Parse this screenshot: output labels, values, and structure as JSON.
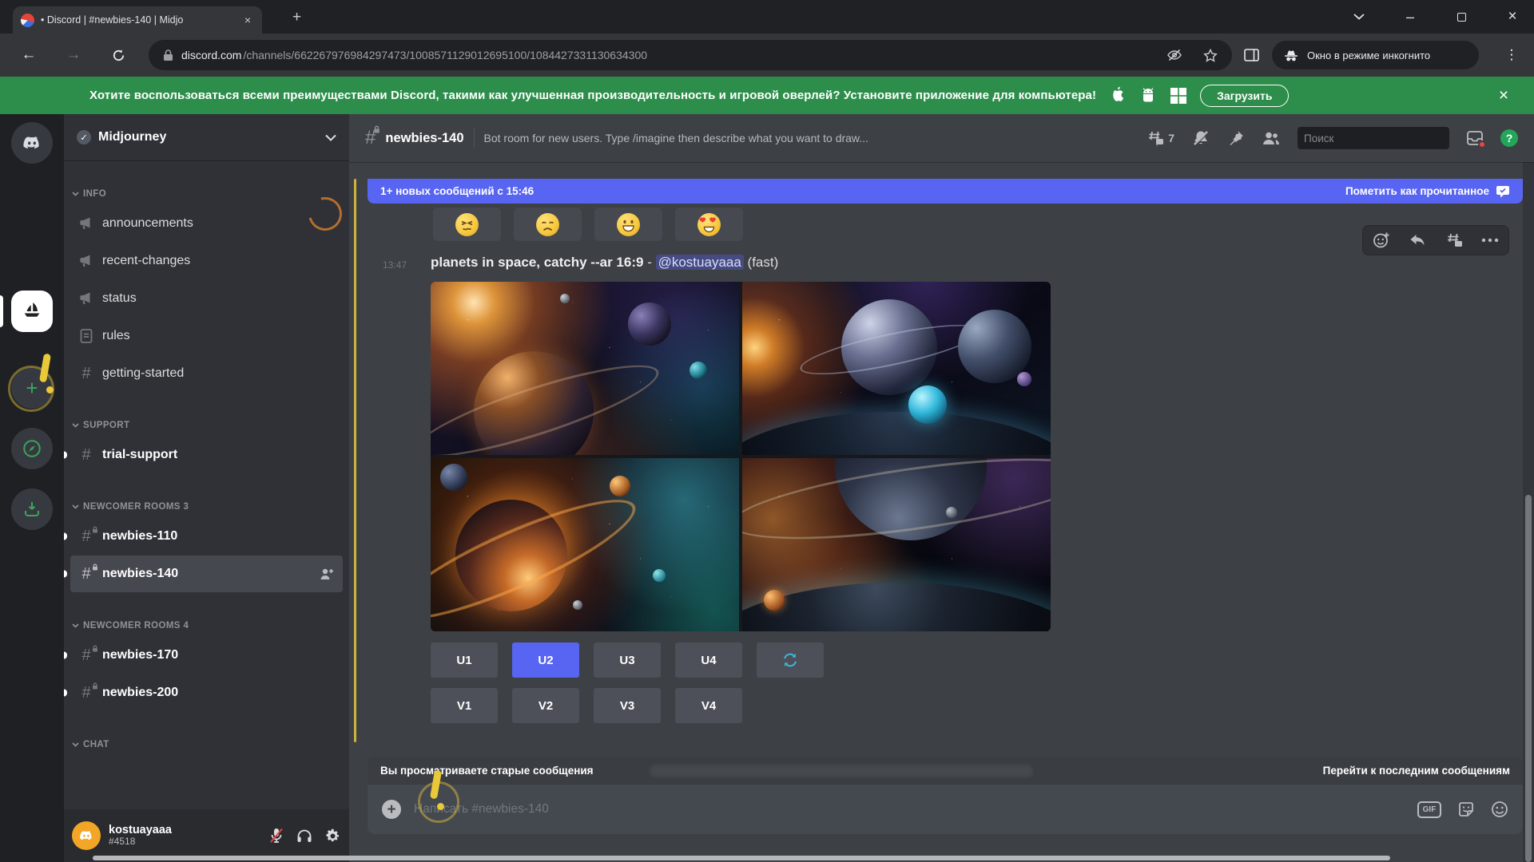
{
  "browser": {
    "tab_title": "• Discord | #newbies-140 | Midjo",
    "url": {
      "domain": "discord.com",
      "path": "/channels/662267976984297473/1008571129012695100/1084427331130634300"
    },
    "incognito_label": "Окно в режиме инкогнито"
  },
  "banner": {
    "text": "Хотите воспользоваться всеми преимуществами Discord, такими как улучшенная производительность и игровой оверлей? Установите приложение для компьютера!",
    "download_label": "Загрузить"
  },
  "sidebar": {
    "server_name": "Midjourney",
    "sections": [
      {
        "label": "INFO",
        "channels": [
          {
            "label": "announcements"
          },
          {
            "label": "recent-changes"
          },
          {
            "label": "status"
          },
          {
            "label": "rules"
          },
          {
            "label": "getting-started"
          }
        ]
      },
      {
        "label": "SUPPORT",
        "channels": [
          {
            "label": "trial-support"
          }
        ]
      },
      {
        "label": "NEWCOMER ROOMS 3",
        "channels": [
          {
            "label": "newbies-110"
          },
          {
            "label": "newbies-140"
          }
        ]
      },
      {
        "label": "NEWCOMER ROOMS 4",
        "channels": [
          {
            "label": "newbies-170"
          },
          {
            "label": "newbies-200"
          }
        ]
      },
      {
        "label": "CHAT",
        "channels": []
      }
    ],
    "user": {
      "name": "kostuayaaa",
      "tag": "#4518"
    }
  },
  "header": {
    "channel_name": "newbies-140",
    "topic": "Bot room for new users. Type /imagine then describe what you want to draw...",
    "thread_count": "7",
    "search_placeholder": "Поиск"
  },
  "unread_bar": {
    "message": "1+ новых сообщений с 15:46",
    "action": "Пометить как прочитанное"
  },
  "message": {
    "time": "13:47",
    "prompt": "planets in space, catchy --ar 16:9",
    "separator": "-",
    "mention": "@kostuayaaa",
    "mode": "(fast)"
  },
  "reactions": [
    {
      "name": "confounded-face"
    },
    {
      "name": "disappointed-face"
    },
    {
      "name": "grinning-face"
    },
    {
      "name": "heart-eyes-face"
    }
  ],
  "mj_buttons": {
    "row1": [
      "U1",
      "U2",
      "U3",
      "U4"
    ],
    "row2": [
      "V1",
      "V2",
      "V3",
      "V4"
    ],
    "selected": "U2"
  },
  "jump_bar": {
    "left": "Вы просматриваете старые сообщения",
    "right": "Перейти к последним сообщениям"
  },
  "composer": {
    "placeholder": "Написать #newbies-140",
    "gif_label": "GIF"
  },
  "icons": {
    "close": "×",
    "plus": "+",
    "minus": "–",
    "back": "←",
    "forward": "→",
    "menu": "⋮",
    "hash": "#",
    "check": "✓",
    "question": "?"
  },
  "colors": {
    "blurple": "#5865f2",
    "banner_green": "#2d8e4b",
    "online_green": "#3ba55d",
    "doodle_yellow": "#e9c83a",
    "refresh_cyan": "#3cb8d9",
    "mention_bg": "rgba(88,101,242,.35)"
  }
}
